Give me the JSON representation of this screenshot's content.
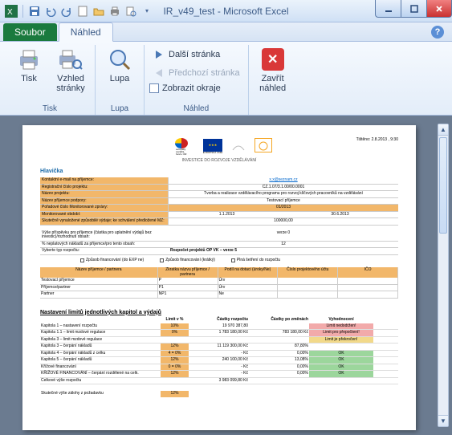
{
  "window": {
    "title": "IR_v49_test - Microsoft Excel"
  },
  "tabs": {
    "file": "Soubor",
    "preview": "Náhled"
  },
  "ribbon": {
    "print": {
      "label": "Tisk",
      "group": "Tisk"
    },
    "pagesetup": {
      "label": "Vzhled\nstránky"
    },
    "zoom": {
      "label": "Lupa",
      "group": "Lupa"
    },
    "nav": {
      "next": "Další stránka",
      "prev": "Předchozí stránka",
      "margins": "Zobrazit okraje",
      "group": "Náhled"
    },
    "close": {
      "label": "Zavřít\nnáhled"
    }
  },
  "doc": {
    "printdate": "Tištěno: 2.8.2013 , 9:30",
    "investice": "INVESTICE DO ROZVOJE VZDĚLÁVÁNÍ",
    "esf_sub": "evropský\nsociální\nfond v ČR",
    "eu_sub": "EVROPSKÁ UNIE",
    "header_title": "Hlavička",
    "rows": {
      "kontakt_lab": "Kontaktní e-mail na příjemce:",
      "kontakt_val": "x.x@seznam.cz",
      "reg_lab": "Registrační číslo projektu:",
      "reg_val": "CZ.1.07/3.1.00/00.0001",
      "nazevp_lab": "Název projektu:",
      "nazevp_val": "Tvorba a realizace vzdělávacího programu pro rozvoj klíčových pracovníků na vzdělávání",
      "prijemce_lab": "Název příjemce podpory:",
      "prijemce_val": "Testovací příjemce",
      "cislozop_lab": "Pořadové číslo Monitorované zprávy:",
      "cislozop_val": "01/2013",
      "monit_lab": "Monitorované období:",
      "monit_od": "1.1.2013",
      "monit_do": "30.6.2013",
      "skut_lab": "Skutečně vynaložené způsobilé výdaje; ke schválení předložené MZ:",
      "skut_val": "100000,00",
      "vyse_lab": "Výše příspěvku pro příjemce (částka pro uplatnění výdajů bez investic)/rozhodnutí obsah:",
      "vyse_val": "verze 0",
      "celk_lab": "% neplatových nákladů za příjemce/pro tento obsah:",
      "celk_val": "12",
      "typ_lab": "Vyberte typ rozpočtu:",
      "typ_val": "Rozpočet projektů OP VK – verze 5"
    },
    "checks": {
      "a": "Způsob financování (do EXP ne)",
      "b": "Způsob financování (krátký)",
      "c": "Plná šetření do rozpočtu"
    },
    "partners_hdr": {
      "name": "Název příjemce / partnera",
      "short": "Zkratka názvu příjemce / partnera",
      "date": "Podíl na dotaci (úroky/Ne)",
      "pose": "Číslo projektového účtu",
      "ico": "IČO"
    },
    "partners": [
      {
        "name": "Testovací příjemce",
        "short": "P",
        "date": "Úrv"
      },
      {
        "name": "Příjemce/partner",
        "short": "P1",
        "date": "Úrv"
      },
      {
        "name": "Partner",
        "short": "NP1",
        "date": "Ne"
      }
    ],
    "limits_title": "Nastavení limitů jednotlivých kapitol a výdajů",
    "limits_hdr": {
      "name": "",
      "pct": "Limit v %",
      "budget": "Částky rozpočtu",
      "ended": "Částky po změnách",
      "status": "Vyhodnocení"
    },
    "limits": [
      {
        "name": "Kapitola 1 – nastavení rozpočtu",
        "pct": "10%",
        "b": "19 970 387,80",
        "e": "",
        "s": "Limit nedodržen!",
        "sc": "over"
      },
      {
        "name": "Kapitola 1.1 – limit mzdové regulace",
        "pct": "0%",
        "b": "1 783 180,00 Kč",
        "e": "783 180,00 Kč",
        "s": "Limit pro přepočtení!",
        "sc": "over"
      },
      {
        "name": "Kapitola 3 – limit mzdové regulace",
        "pct": "",
        "b": "",
        "e": "",
        "s": "Limit je překročen!",
        "sc": "warn"
      },
      {
        "name": "Kapitola 3 – čerpání nákladů",
        "pct": "12%",
        "b": "11 119 300,00 Kč",
        "e": "87,80%",
        "s": "",
        "sc": ""
      },
      {
        "name": "Kapitola 4 – čerpání nákladů z celku",
        "pct": "4 = 0%",
        "b": "- Kč",
        "e": "0,00%",
        "s": "OK",
        "sc": "ok"
      },
      {
        "name": "Kapitola 5 – čerpání nákladů",
        "pct": "12%",
        "b": "240 100,00 Kč",
        "e": "13,08%",
        "s": "OK",
        "sc": "ok"
      },
      {
        "name": "Křížové financování",
        "pct": "0 = 0%",
        "b": "- Kč",
        "e": "0,00%",
        "s": "OK",
        "sc": "ok"
      },
      {
        "name": "KŘÍŽOVÉ FINANCOVÁNÍ – čerpání rozdělené na celk.",
        "pct": "12%",
        "b": "- Kč",
        "e": "0,00%",
        "s": "OK",
        "sc": "ok"
      },
      {
        "name": "Celkové výše rozpočtu",
        "pct": "",
        "b": "3 983 099,80 Kč",
        "e": "",
        "s": "",
        "sc": ""
      }
    ],
    "footer_lab": "Skutečné výše zálohy z požadavku",
    "footer_pct": "12%"
  }
}
